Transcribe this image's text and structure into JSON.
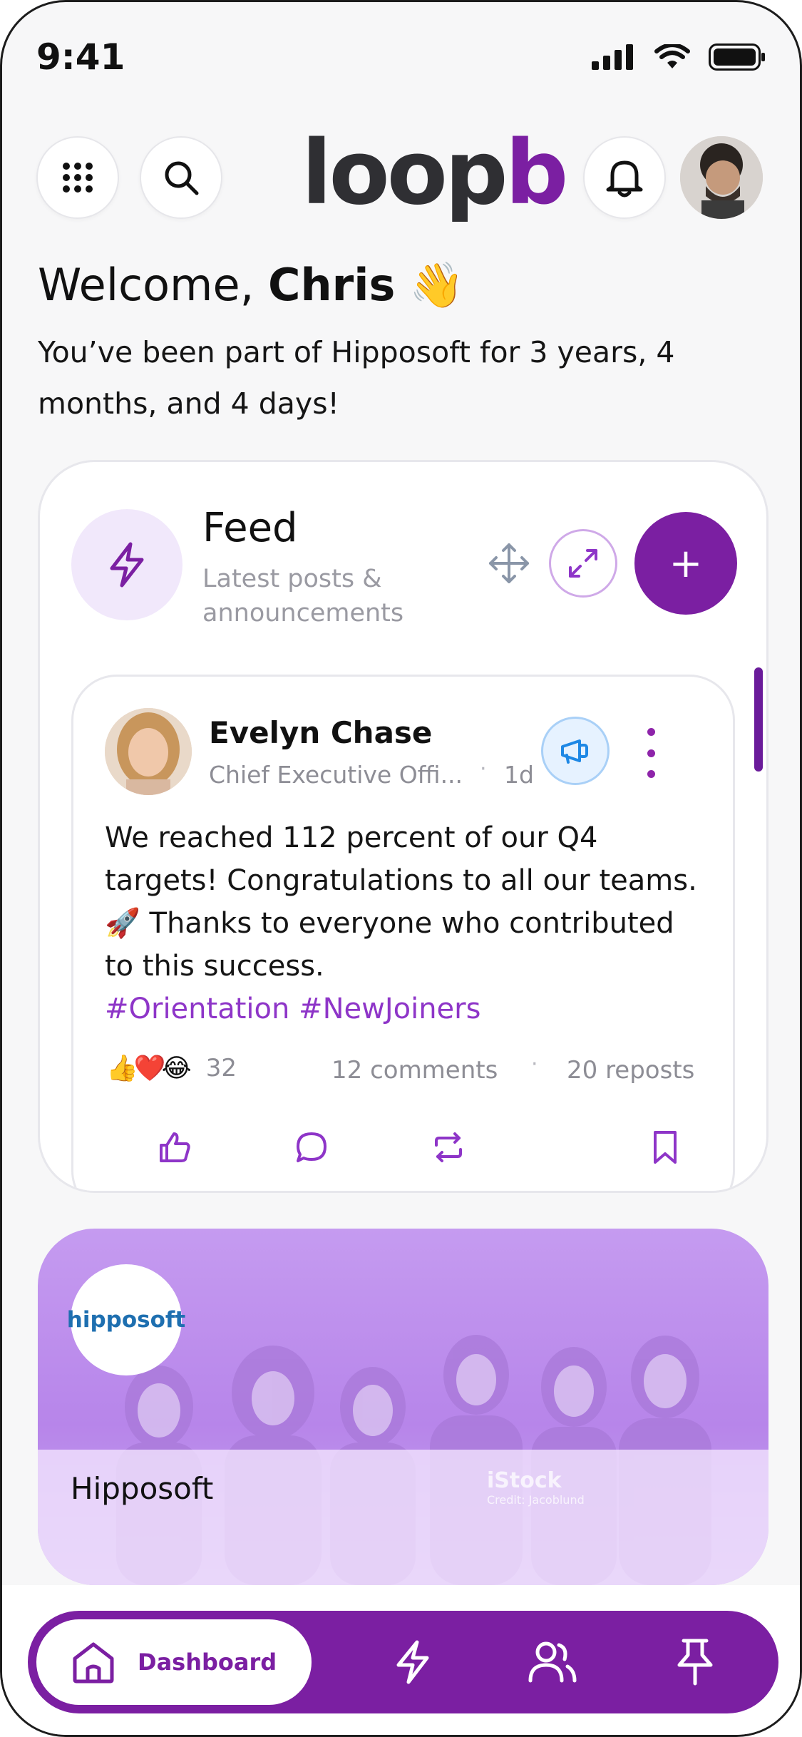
{
  "status_bar": {
    "time": "9:41"
  },
  "header": {
    "logo_left": "loop",
    "logo_right": "b",
    "icons": [
      "apps-grid-icon",
      "search-icon",
      "bell-icon",
      "avatar"
    ]
  },
  "welcome": {
    "greeting": "Welcome, ",
    "name": "Chris",
    "emoji": "👋",
    "subtitle": "You’ve been part of Hipposoft for 3 years, 4 months, and 4 days!"
  },
  "feed": {
    "title": "Feed",
    "subtitle": "Latest posts & announcements",
    "add_label": "+",
    "post": {
      "author": "Evelyn Chase",
      "role": "Chief Executive Offi...",
      "dot": "·",
      "time": "1d",
      "body": "We reached 112 percent of our Q4 targets! Congratulations to all our teams. 🚀 Thanks to everyone who contributed to this success.",
      "hashtags": "#Orientation #NewJoiners",
      "reactions": [
        "👍",
        "❤️",
        "😂"
      ],
      "reaction_count": "32",
      "comments": "12 comments",
      "reposts": "20 reposts"
    }
  },
  "company": {
    "logo_text": "hipposoft",
    "name": "Hipposoft",
    "watermark_title": "iStock",
    "watermark_credit": "Credit: Jacoblund"
  },
  "bottom_nav": {
    "active_label": "Dashboard",
    "items": [
      "home-icon",
      "lightning-icon",
      "people-icon",
      "pin-icon"
    ]
  },
  "colors": {
    "accent": "#7b1fa2",
    "accent_light": "#f1e8fb",
    "hashtag": "#8e35c8",
    "announce_blue": "#1e88e5"
  }
}
